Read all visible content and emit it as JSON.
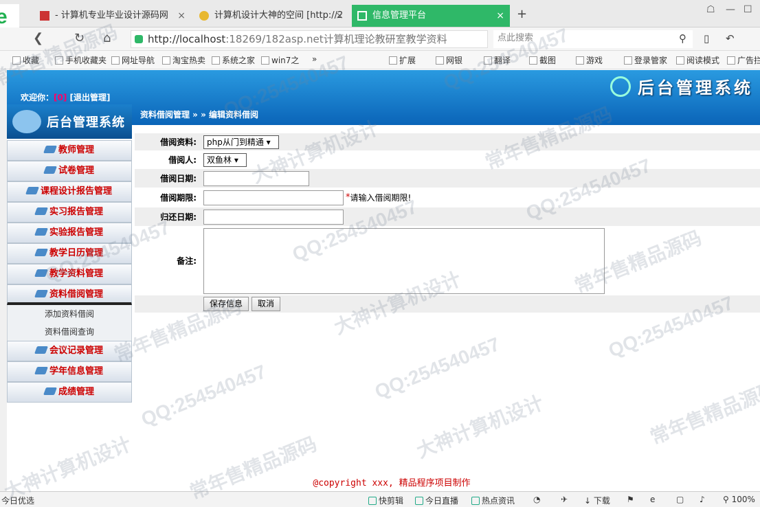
{
  "browser": {
    "tabs": [
      {
        "label": "- 计算机专业毕业设计源码网",
        "close": "×"
      },
      {
        "label": "计算机设计大神的空间 [http://2",
        "close": "×"
      },
      {
        "label": "信息管理平台",
        "close": "×"
      }
    ],
    "new_tab": "+",
    "url_host": "http://localhost",
    "url_rest": ":18269/182asp.net计算机理论教研室教学资料",
    "search_placeholder": "点此搜索",
    "bookmarks": [
      "收藏",
      "手机收藏夹",
      "网址导航",
      "淘宝热卖",
      "系统之家",
      "win7之",
      "»",
      "扩展",
      "网银",
      "翻译",
      "截图",
      "游戏",
      "登录管家",
      "阅读模式",
      "广告拦"
    ],
    "status": [
      "今日优选",
      "快剪辑",
      "今日直播",
      "热点资讯",
      "下载",
      "100%"
    ]
  },
  "header": {
    "system_title": "后台管理系统",
    "welcome_prefix": "欢迎你：",
    "username": "[0]",
    "logout": "[退出管理]",
    "side_logo": "后台管理系统",
    "breadcrumb": "资料借阅管理 » » 编辑资料借阅"
  },
  "menu": {
    "items": [
      {
        "label": "教师管理"
      },
      {
        "label": "试卷管理"
      },
      {
        "label": "课程设计报告管理"
      },
      {
        "label": "实习报告管理"
      },
      {
        "label": "实验报告管理"
      },
      {
        "label": "教学日历管理"
      },
      {
        "label": "教学资料管理"
      },
      {
        "label": "资料借阅管理"
      }
    ],
    "sub_items": [
      "添加资料借阅",
      "资料借阅查询"
    ],
    "items_after": [
      {
        "label": "会议记录管理"
      },
      {
        "label": "学年信息管理"
      },
      {
        "label": "成绩管理"
      }
    ]
  },
  "form": {
    "material_label": "借阅资料:",
    "material_value": "php从门到精通",
    "borrower_label": "借阅人:",
    "borrower_value": "双鱼林",
    "date_label": "借阅日期:",
    "date_value": "",
    "period_label": "借阅期限:",
    "period_value": "",
    "required_mark": "*",
    "period_hint": "请输入借阅期限!",
    "return_label": "归还日期:",
    "return_value": "",
    "notes_label": "备注:",
    "notes_value": "",
    "save_button": "保存信息",
    "cancel_button": "取消"
  },
  "footer": {
    "copyright": "@copyright xxx, 精品程序项目制作"
  },
  "watermark": {
    "texts": [
      "常年售精品源码",
      "QQ:254540457",
      "大神计算机设计"
    ]
  },
  "colors": {
    "accent": "#2fb868",
    "header_blue": "#0a64b8",
    "menu_text": "#cc0000",
    "copyright": "#cc0000"
  }
}
